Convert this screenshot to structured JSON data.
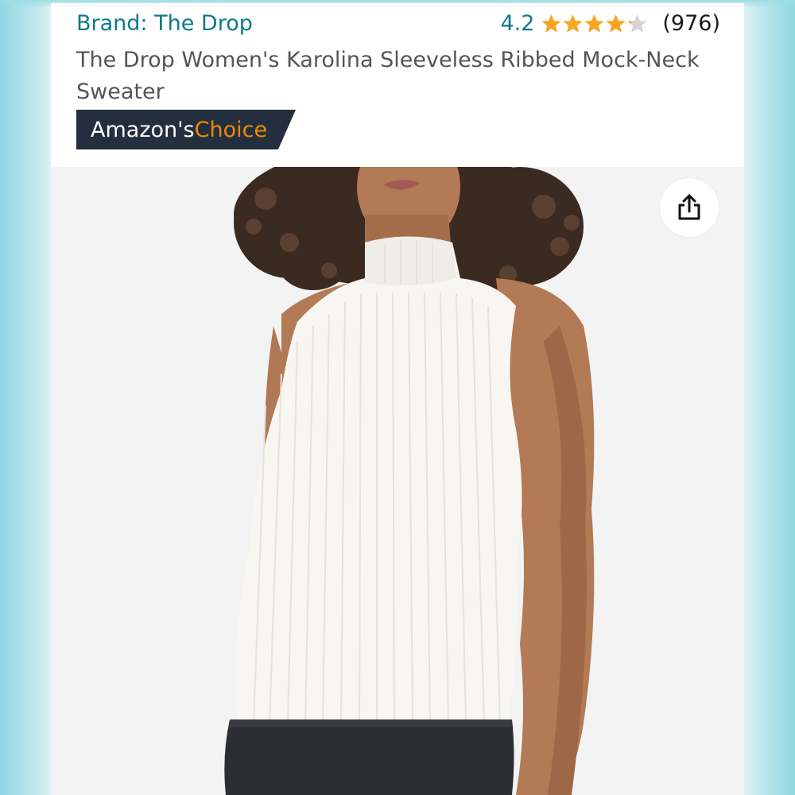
{
  "product": {
    "brand": "Brand: The Drop",
    "rating_value": "4.2",
    "rating": 4.2,
    "rating_max": 5,
    "review_count": "(976)",
    "title": "The Drop Women's Karolina Sleeveless Ribbed Mock-Neck Sweater",
    "badge_prefix": "Amazon's ",
    "badge_highlight": "Choice"
  },
  "icons": {
    "share": "share-icon",
    "star": "star-icon"
  },
  "colors": {
    "brand_link": "#0f7a8c",
    "star_fill": "#f5a623",
    "star_empty": "#d5d5d5",
    "badge_bg": "#232f3e",
    "badge_highlight": "#f08804"
  }
}
